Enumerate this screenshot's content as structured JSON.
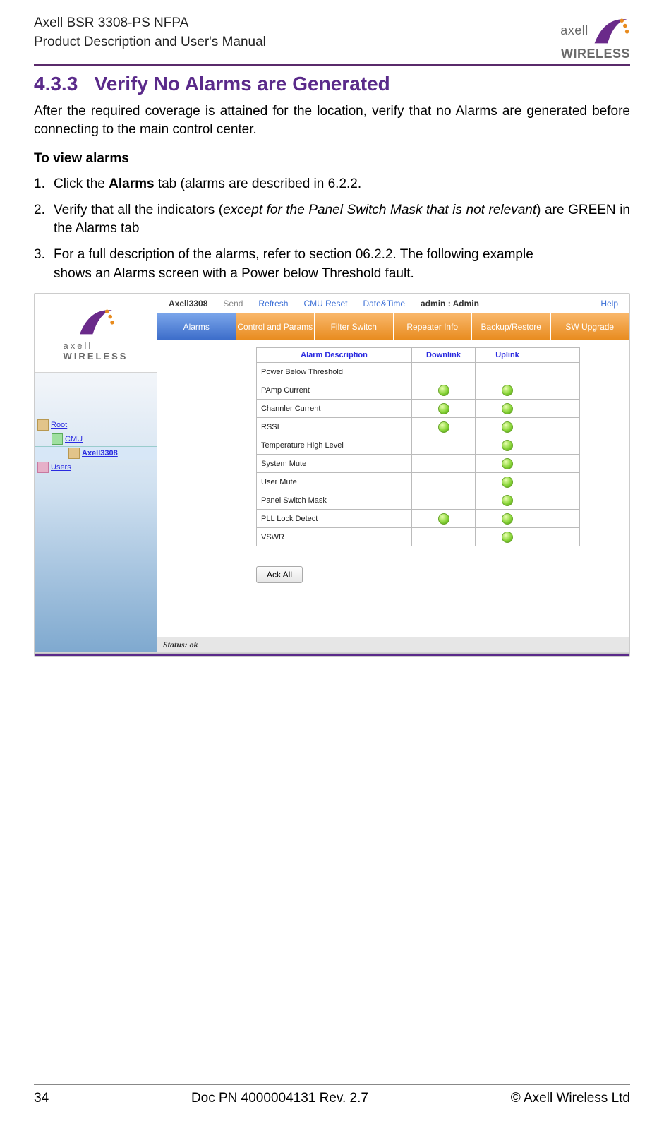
{
  "header": {
    "line1": "Axell BSR 3308-PS NFPA",
    "line2": "Product Description and User's Manual",
    "logo_text_light": "axell",
    "logo_text_bold": "WIRELESS"
  },
  "section": {
    "number": "4.3.3",
    "title": "Verify No Alarms are Generated"
  },
  "lead": "After the required coverage is attained for the location, verify that no Alarms are generated before connecting to the main control center.",
  "subhead": "To view alarms",
  "steps": [
    {
      "pre": "Click the ",
      "bold": "Alarms",
      "post": " tab (alarms are described in 6.2.2."
    },
    {
      "pre": "Verify that all the indicators (",
      "em": "except for the Panel Switch Mask that is not relevant",
      "post": ") are GREEN in the Alarms tab"
    },
    {
      "pre": "For a full description of the alarms, refer to section ",
      "mid": " 06.2.2. The following example",
      "post2": "shows an Alarms screen with a Power below Threshold fault."
    }
  ],
  "app": {
    "brand_light": "axell",
    "brand_bold": "WIRELESS",
    "tree": {
      "root": "Root",
      "cmu": "CMU",
      "axell": "Axell3308",
      "users": "Users"
    },
    "toolbar": {
      "name": "Axell3308",
      "send": "Send",
      "refresh": "Refresh",
      "cmu_reset": "CMU Reset",
      "datetime": "Date&Time",
      "admin": "admin : Admin",
      "help": "Help"
    },
    "tabs": [
      "Alarms",
      "Control and Params",
      "Filter Switch",
      "Repeater Info",
      "Backup/Restore",
      "SW Upgrade"
    ],
    "alarm_headers": {
      "desc": "Alarm Description",
      "downlink": "Downlink",
      "uplink": "Uplink"
    },
    "alarms": [
      {
        "label": "Power Below Threshold",
        "dl": false,
        "ul": false
      },
      {
        "label": "PAmp Current",
        "dl": true,
        "ul": true
      },
      {
        "label": "Channler Current",
        "dl": true,
        "ul": true
      },
      {
        "label": "RSSI",
        "dl": true,
        "ul": true
      },
      {
        "label": "Temperature High Level",
        "dl": false,
        "ul": true
      },
      {
        "label": "System Mute",
        "dl": false,
        "ul": true
      },
      {
        "label": "User Mute",
        "dl": false,
        "ul": true
      },
      {
        "label": "Panel Switch Mask",
        "dl": false,
        "ul": true
      },
      {
        "label": "PLL Lock Detect",
        "dl": true,
        "ul": true
      },
      {
        "label": "VSWR",
        "dl": false,
        "ul": true
      }
    ],
    "ack_all": "Ack All",
    "status": "Status: ok"
  },
  "footer": {
    "page": "34",
    "doc": "Doc PN 4000004131 Rev. 2.7",
    "copy": "© Axell Wireless Ltd"
  }
}
